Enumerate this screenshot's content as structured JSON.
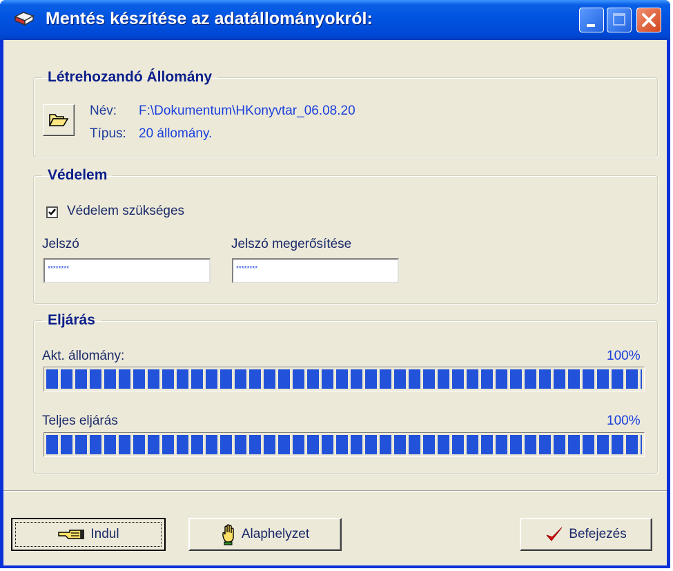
{
  "window": {
    "title": "Mentés készítése az adatállományokról:",
    "icon": "book-icon",
    "controls": [
      "minimize-icon",
      "maximize-icon",
      "close-icon"
    ]
  },
  "file_group": {
    "legend": "Létrehozandó Állomány",
    "name_label": "Név:",
    "name_value": "F:\\Dokumentum\\HKonyvtar_06.08.20",
    "type_label": "Típus:",
    "type_value": "20 állomány.",
    "browse_icon": "folder-open-icon"
  },
  "protection_group": {
    "legend": "Védelem",
    "checkbox_label": "Védelem szükséges",
    "checkbox_checked": true,
    "password_label": "Jelszó",
    "password_value": "********",
    "confirm_label": "Jelszó megerősítése",
    "confirm_value": "********"
  },
  "process_group": {
    "legend": "Eljárás",
    "current_label": "Akt. állomány:",
    "current_percent_text": "100%",
    "current_progress": 1.0,
    "total_label": "Teljes eljárás",
    "total_percent_text": "100%",
    "total_progress": 1.0
  },
  "buttons": {
    "start_label": "Indul",
    "reset_label": "Alaphelyzet",
    "finish_label": "Befejezés"
  },
  "colors": {
    "titlebar": "#0053e1",
    "window_bg": "#ece9d8",
    "progress_fill": "#2252d9",
    "value_text": "#1a3fdc"
  }
}
